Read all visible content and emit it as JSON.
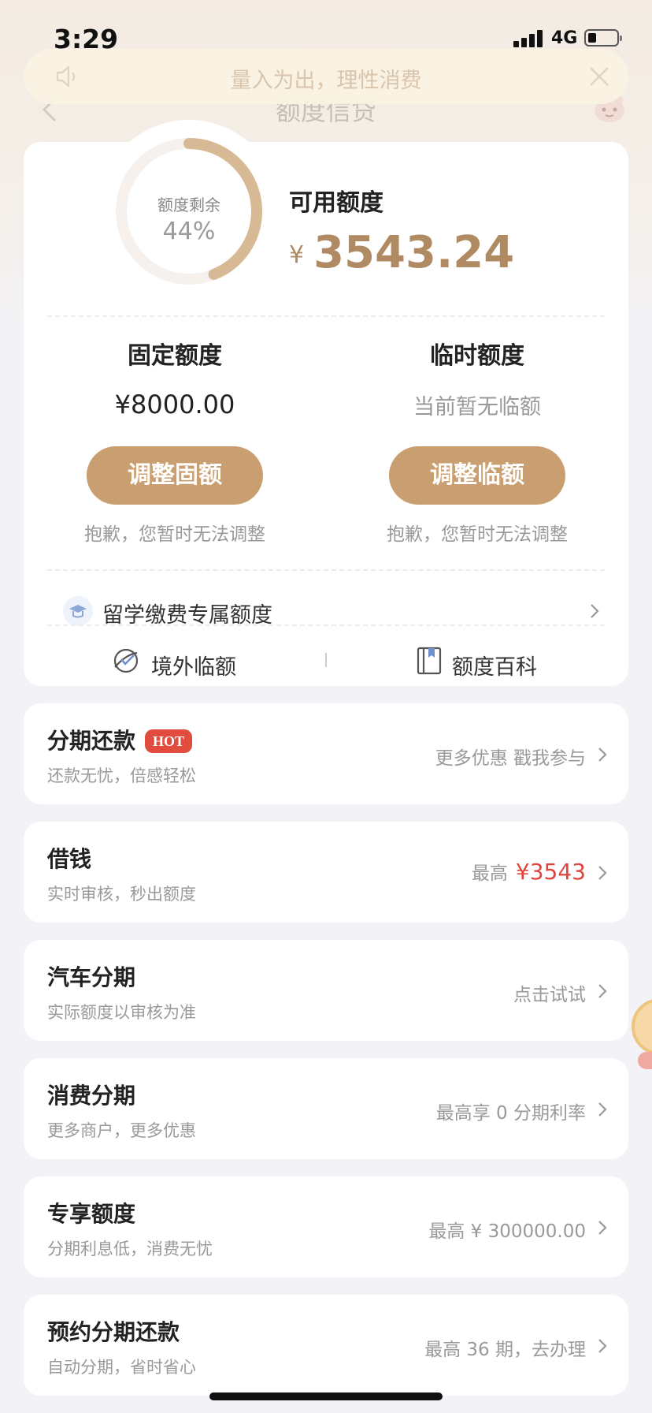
{
  "status_bar": {
    "time": "3:29",
    "network": "4G"
  },
  "nav": {
    "title": "额度信贷"
  },
  "notice": {
    "text": "量入为出，理性消费"
  },
  "quota": {
    "gauge_label": "额度剩余",
    "gauge_percent_text": "44%",
    "remaining_fraction": 0.44,
    "available_label": "可用额度",
    "currency": "¥",
    "available_amount": "3543.24"
  },
  "fixed": {
    "title": "固定额度",
    "value": "¥8000.00",
    "button": "调整固额",
    "note": "抱歉，您暂时无法调整"
  },
  "temp": {
    "title": "临时额度",
    "value": "当前暂无临额",
    "button": "调整临额",
    "note": "抱歉，您暂时无法调整"
  },
  "study": {
    "label": "留学缴费专属额度"
  },
  "links": {
    "overseas": "境外临额",
    "wiki": "额度百科"
  },
  "items": [
    {
      "title": "分期还款",
      "badge": "HOT",
      "subtitle": "还款无忧，倍感轻松",
      "right": "更多优惠 戳我参与"
    },
    {
      "title": "借钱",
      "subtitle": "实时审核，秒出额度",
      "right_prefix": "最高",
      "right_amount": "¥3543"
    },
    {
      "title": "汽车分期",
      "subtitle": "实际额度以审核为准",
      "right": "点击试试"
    },
    {
      "title": "消费分期",
      "subtitle": "更多商户，更多优惠",
      "right": "最高享 0 分期利率"
    },
    {
      "title": "专享额度",
      "subtitle": "分期利息低，消费无忧",
      "right": "最高 ¥ 300000.00"
    },
    {
      "title": "预约分期还款",
      "subtitle": "自动分期，省时省心",
      "right": "最高 36 期，去办理"
    }
  ],
  "colors": {
    "accent": "#c99e70",
    "amount": "#b08a62",
    "hot": "#e24c3f",
    "price_red": "#e0443f"
  }
}
